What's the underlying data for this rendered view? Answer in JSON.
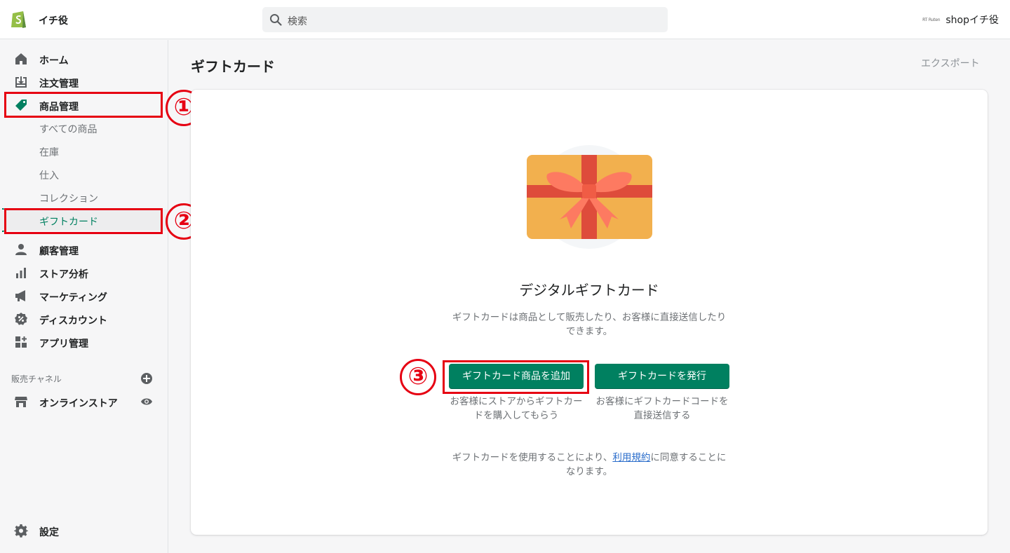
{
  "topbar": {
    "store_name": "イチ役",
    "search_placeholder": "検索",
    "account_brand_mini": "RT Ruten",
    "account_name": "shopイチ役"
  },
  "sidebar": {
    "items": [
      {
        "label": "ホーム",
        "icon": "home-icon"
      },
      {
        "label": "注文管理",
        "icon": "orders-icon"
      },
      {
        "label": "商品管理",
        "icon": "tag-icon"
      },
      {
        "label": "顧客管理",
        "icon": "customer-icon"
      },
      {
        "label": "ストア分析",
        "icon": "analytics-icon"
      },
      {
        "label": "マーケティング",
        "icon": "megaphone-icon"
      },
      {
        "label": "ディスカウント",
        "icon": "discount-icon"
      },
      {
        "label": "アプリ管理",
        "icon": "apps-icon"
      }
    ],
    "product_subitems": [
      "すべての商品",
      "在庫",
      "仕入",
      "コレクション",
      "ギフトカード"
    ],
    "sales_channels_label": "販売チャネル",
    "online_store_label": "オンラインストア",
    "settings_label": "設定"
  },
  "annotations": {
    "step1": "①",
    "step2": "②",
    "step3": "③",
    "color": "#e60012"
  },
  "main": {
    "page_title": "ギフトカード",
    "export_label": "エクスポート",
    "empty_title": "デジタルギフトカード",
    "empty_desc": "ギフトカードは商品として販売したり、お客様に直接送信したりできます。",
    "primary_button": "ギフトカード商品を追加",
    "primary_note": "お客様にストアからギフトカードを購入してもらう",
    "secondary_button": "ギフトカードを発行",
    "secondary_note": "お客様にギフトカードコードを直接送信する",
    "terms_before": "ギフトカードを使用することにより、",
    "terms_link": "利用規約",
    "terms_after": "に同意することになります。"
  },
  "colors": {
    "accent": "#008060",
    "link": "#2c6ecb"
  }
}
